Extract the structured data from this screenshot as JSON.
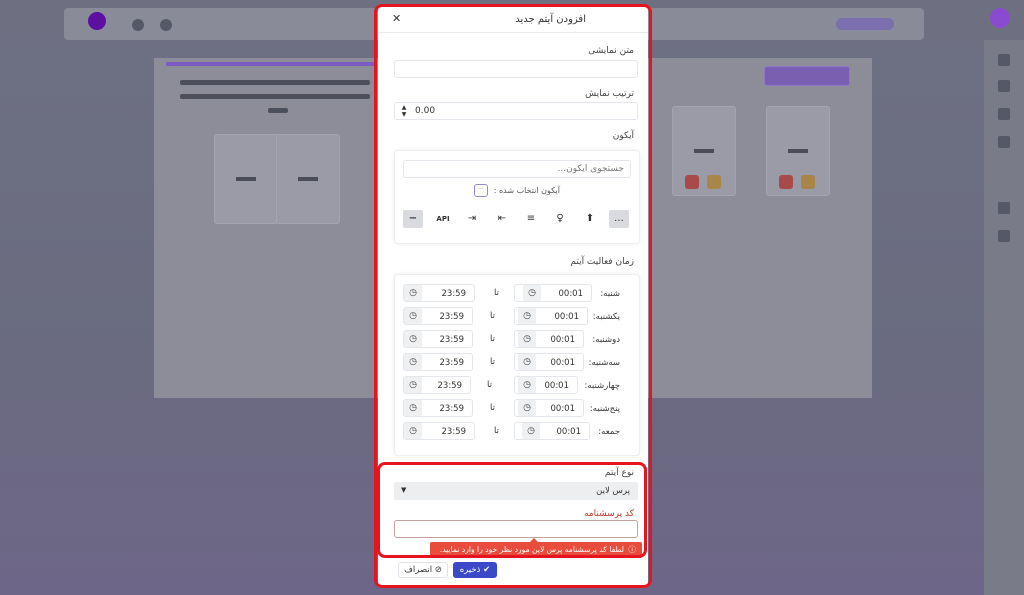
{
  "modal": {
    "title": "افزودن آیتم جدید",
    "close_symbol": "✕",
    "display_text": {
      "label": "متن نمایشی",
      "value": ""
    },
    "display_order": {
      "label": "ترتیب نمایش",
      "value": "0.00"
    },
    "icon": {
      "label": "آیکون",
      "search_placeholder": "جستجوی آیکون...",
      "selected_label": "آیکون انتخاب شده :",
      "selected_icon": "comment-icon",
      "options": [
        "minus-icon",
        "api-icon",
        "align-right-icon",
        "align-left-icon",
        "align-center-icon",
        "lightbulb-icon",
        "upload-icon",
        "ellipsis-icon"
      ],
      "options_text": [
        "−",
        "API",
        "⇥",
        "⇤",
        "≡",
        "♀",
        "⬆",
        "…"
      ]
    },
    "schedule": {
      "label": "زمان فعالیت آیتم",
      "to_label": "تا",
      "days": [
        {
          "day": "شنبه:",
          "from": "00:01",
          "to": "23:59"
        },
        {
          "day": "یکشنبه:",
          "from": "00:01",
          "to": "23:59"
        },
        {
          "day": "دوشنبه:",
          "from": "00:01",
          "to": "23:59"
        },
        {
          "day": "سه‌شنبه:",
          "from": "00:01",
          "to": "23:59"
        },
        {
          "day": "چهارشنبه:",
          "from": "00:01",
          "to": "23:59"
        },
        {
          "day": "پنج‌شنبه:",
          "from": "00:01",
          "to": "23:59"
        },
        {
          "day": "جمعه:",
          "from": "00:01",
          "to": "23:59"
        }
      ]
    },
    "item_type": {
      "label": "نوع آیتم",
      "value": "پرس لاین"
    },
    "questionnaire_code": {
      "label": "کد پرسشنامه",
      "value": "",
      "error": "لطفا کد پرسشنامه پرس لاین مورد نظر خود را وارد نمایید."
    },
    "buttons": {
      "save": "ذخیره",
      "cancel": "انصراف"
    }
  },
  "colors": {
    "primary": "#3b49c8",
    "error": "#e74c3c",
    "highlight": "#e5141e",
    "overlay": "#6e7082"
  }
}
